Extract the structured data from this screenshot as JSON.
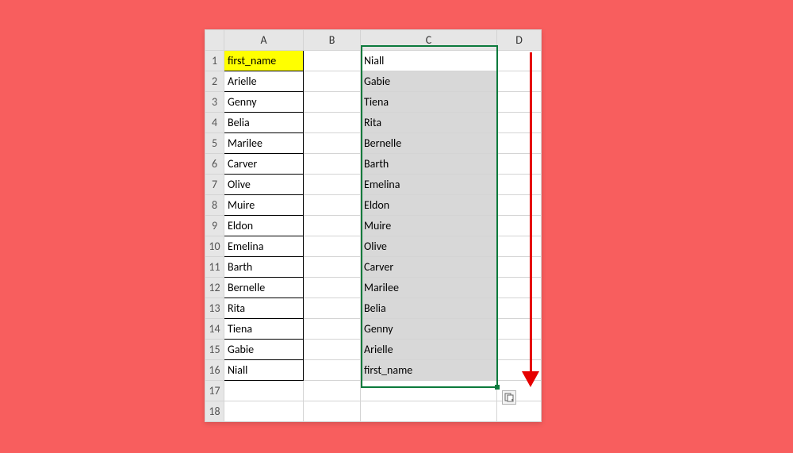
{
  "columns": {
    "corner": "",
    "A": "A",
    "B": "B",
    "C": "C",
    "D": "D"
  },
  "rows": [
    {
      "n": "1",
      "A": "first_name",
      "C": "Niall",
      "Ayellow": true,
      "Cselfirst": true
    },
    {
      "n": "2",
      "A": "Arielle",
      "C": "Gabie"
    },
    {
      "n": "3",
      "A": "Genny",
      "C": "Tiena"
    },
    {
      "n": "4",
      "A": "Belia",
      "C": "Rita"
    },
    {
      "n": "5",
      "A": "Marilee",
      "C": "Bernelle"
    },
    {
      "n": "6",
      "A": "Carver",
      "C": "Barth"
    },
    {
      "n": "7",
      "A": "Olive",
      "C": "Emelina"
    },
    {
      "n": "8",
      "A": "Muire",
      "C": "Eldon"
    },
    {
      "n": "9",
      "A": "Eldon",
      "C": "Muire"
    },
    {
      "n": "10",
      "A": "Emelina",
      "C": "Olive"
    },
    {
      "n": "11",
      "A": "Barth",
      "C": "Carver"
    },
    {
      "n": "12",
      "A": "Bernelle",
      "C": "Marilee"
    },
    {
      "n": "13",
      "A": "Rita",
      "C": "Belia"
    },
    {
      "n": "14",
      "A": "Tiena",
      "C": "Genny"
    },
    {
      "n": "15",
      "A": "Gabie",
      "C": "Arielle"
    },
    {
      "n": "16",
      "A": "Niall",
      "C": "first_name"
    },
    {
      "n": "17",
      "A": "",
      "C": "",
      "noAborder": true,
      "noCsel": true
    },
    {
      "n": "18",
      "A": "",
      "C": "",
      "noAborder": true,
      "noCsel": true
    }
  ]
}
